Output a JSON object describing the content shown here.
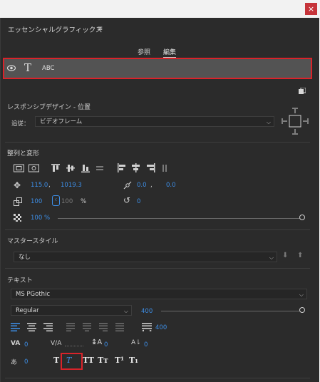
{
  "window": {
    "close_glyph": "×"
  },
  "panel": {
    "title": "エッセンシャルグラフィックス",
    "menu_icon": "hamburger-menu-icon"
  },
  "tabs": [
    {
      "label": "参照",
      "active": false
    },
    {
      "label": "編集",
      "active": true
    }
  ],
  "layer": {
    "name": "ABC",
    "eye_icon": "eye-icon",
    "type_icon": "text-layer-icon"
  },
  "responsive": {
    "title": "レスポンシブデザイン - 位置",
    "follow_label": "追従：",
    "follow_value": "ビデオフレーム"
  },
  "align": {
    "title": "整列と変形",
    "position": {
      "x": "115.0",
      "sep": ",",
      "y": "1019.3"
    },
    "anchor": {
      "x": "0.0",
      "sep": ",",
      "y": "0.0"
    },
    "scale": {
      "w": "100",
      "h": "100",
      "unit": "%"
    },
    "rotation": "0",
    "opacity": {
      "value": "100",
      "unit": "%"
    }
  },
  "master_style": {
    "title": "マスタースタイル",
    "value": "なし"
  },
  "text": {
    "title": "テキスト",
    "font": "MS PGothic",
    "style": "Regular",
    "size": "400",
    "size_slider_fraction": 1.0,
    "tracking_value": "400",
    "kerning": "0",
    "leading": "0",
    "baseline": "0",
    "tsume": "0",
    "style_buttons": [
      {
        "label": "T",
        "name": "faux-bold-button"
      },
      {
        "label": "T",
        "name": "faux-italic-button"
      },
      {
        "label": "TT",
        "name": "all-caps-button"
      },
      {
        "label": "Tт",
        "name": "small-caps-button"
      },
      {
        "label": "T¹",
        "name": "superscript-button"
      },
      {
        "label": "T₁",
        "name": "subscript-button"
      }
    ]
  },
  "colors": {
    "accent": "#3d8ee6",
    "highlight": "#d9232a",
    "panel_bg": "#2b2b2b"
  }
}
